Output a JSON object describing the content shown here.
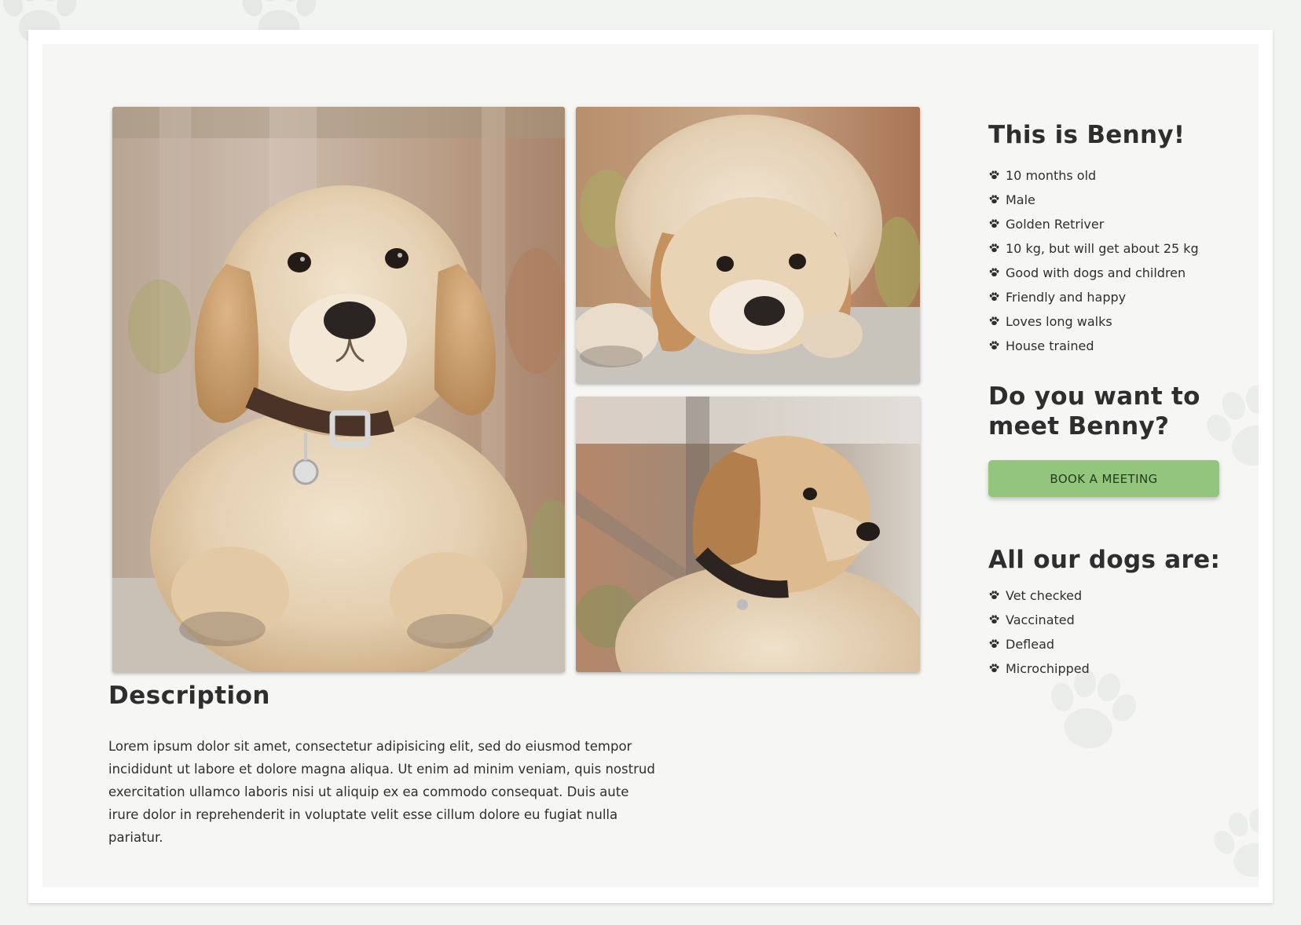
{
  "dog": {
    "title": "This is Benny!",
    "facts": [
      "10 months old",
      "Male",
      "Golden Retriver",
      "10 kg, but will get about 25 kg",
      "Good with dogs and children",
      "Friendly and happy",
      "Loves long walks",
      "House trained"
    ]
  },
  "meet": {
    "title": "Do you want to meet Benny?",
    "button_label": "Book a meeting"
  },
  "all_dogs": {
    "title": "All our dogs are:",
    "items": [
      "Vet checked",
      "Vaccinated",
      "Deflead",
      "Microchipped"
    ]
  },
  "description": {
    "title": "Description",
    "text": "Lorem ipsum dolor sit amet, consectetur adipisicing elit, sed do eiusmod tempor incididunt ut labore et dolore magna aliqua. Ut enim ad minim veniam, quis nostrud exercitation ullamco laboris nisi ut aliquip ex ea commodo consequat. Duis aute irure dolor in reprehenderit in voluptate velit esse cillum dolore eu fugiat nulla pariatur."
  },
  "photos": [
    {
      "icon": "puppy-photo-sitting"
    },
    {
      "icon": "puppy-photo-lying"
    },
    {
      "icon": "puppy-photo-profile"
    }
  ],
  "colors": {
    "accent": "#93c67c",
    "text": "#2e2e2e",
    "page_bg": "#f2f4f1",
    "card_bg": "#f6f7f5"
  }
}
